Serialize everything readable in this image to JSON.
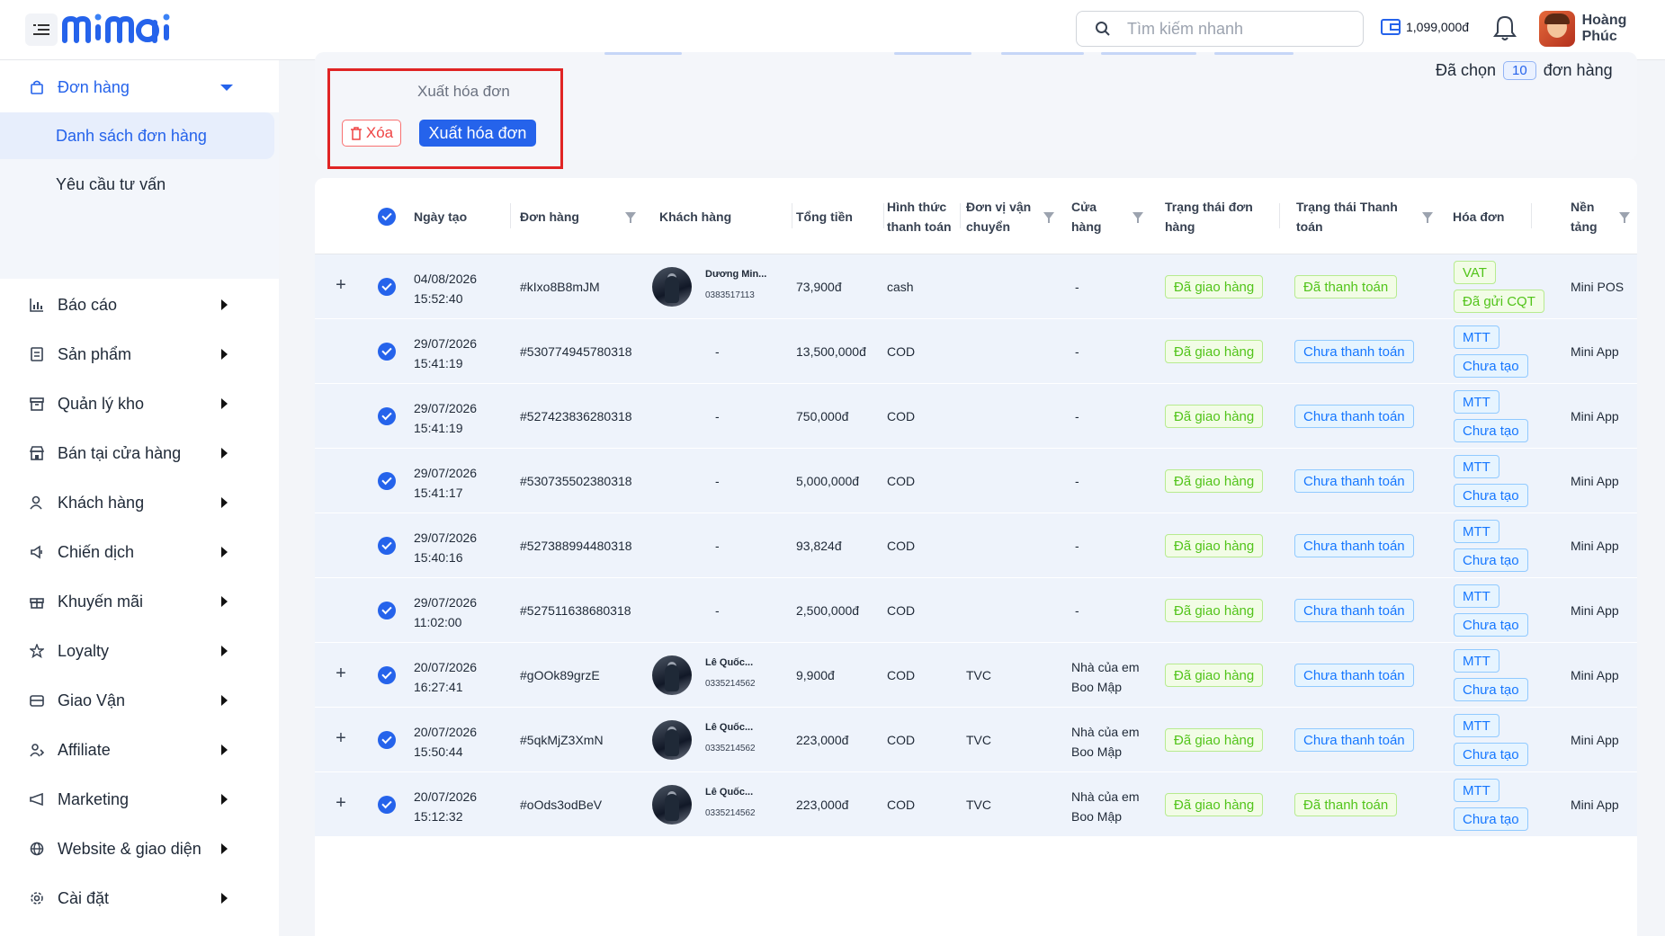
{
  "header": {
    "logo_text": "mimai",
    "search_placeholder": "Tìm kiếm nhanh",
    "wallet_balance": "1,099,000đ",
    "user_name": "Hoàng Phúc"
  },
  "sidebar": {
    "items": [
      {
        "label": "Đơn hàng",
        "icon": "bag-icon"
      },
      {
        "label": "Báo cáo",
        "icon": "chart-icon"
      },
      {
        "label": "Sản phẩm",
        "icon": "product-icon"
      },
      {
        "label": "Quản lý kho",
        "icon": "warehouse-icon"
      },
      {
        "label": "Bán tại cửa hàng",
        "icon": "store-icon"
      },
      {
        "label": "Khách hàng",
        "icon": "customer-icon"
      },
      {
        "label": "Chiến dịch",
        "icon": "campaign-icon"
      },
      {
        "label": "Khuyến mãi",
        "icon": "gift-icon"
      },
      {
        "label": "Loyalty",
        "icon": "star-icon"
      },
      {
        "label": "Giao Vận",
        "icon": "delivery-icon"
      },
      {
        "label": "Affiliate",
        "icon": "affiliate-icon"
      },
      {
        "label": "Marketing",
        "icon": "megaphone-icon"
      },
      {
        "label": "Website & giao diện",
        "icon": "globe-icon"
      },
      {
        "label": "Cài đặt",
        "icon": "gear-icon"
      }
    ],
    "sub_items": [
      "Danh sách đơn hàng",
      "Yêu cầu tư vấn"
    ]
  },
  "actions": {
    "title": "Xuất hóa đơn",
    "delete_label": "Xóa",
    "export_label": "Xuất hóa đơn",
    "selected_prefix": "Đã chọn",
    "selected_count": "10",
    "selected_suffix": "đơn hàng"
  },
  "table": {
    "columns": {
      "created": "Ngày tạo",
      "order": "Đơn hàng",
      "customer": "Khách hàng",
      "total": "Tổng tiền",
      "payment_method": "Hình thức thanh toán",
      "carrier": "Đơn vị vận chuyển",
      "store": "Cửa hàng",
      "order_status": "Trạng thái đơn hàng",
      "payment_status": "Trạng thái Thanh toán",
      "invoice": "Hóa đơn",
      "platform": "Nền tảng"
    },
    "rows": [
      {
        "date": "04/08/2026",
        "time": "15:52:40",
        "order": "#kIxo8B8mJM",
        "customer_name": "Dương Min...",
        "customer_phone": "0383517113",
        "total": "73,900đ",
        "method": "cash",
        "carrier": "",
        "store": "-",
        "store2": "",
        "order_status": "Đã giao hàng",
        "payment_status": "Đã thanh toán",
        "invoice1": "VAT",
        "invoice2": "Đã gửi CQT",
        "platform": "Mini POS"
      },
      {
        "date": "29/07/2026",
        "time": "15:41:19",
        "order": "#530774945780318",
        "customer_name": "-",
        "customer_phone": "",
        "total": "13,500,000đ",
        "method": "COD",
        "carrier": "",
        "store": "-",
        "store2": "",
        "order_status": "Đã giao hàng",
        "payment_status": "Chưa thanh toán",
        "invoice1": "MTT",
        "invoice2": "Chưa tạo",
        "platform": "Mini App"
      },
      {
        "date": "29/07/2026",
        "time": "15:41:19",
        "order": "#527423836280318",
        "customer_name": "-",
        "customer_phone": "",
        "total": "750,000đ",
        "method": "COD",
        "carrier": "",
        "store": "-",
        "store2": "",
        "order_status": "Đã giao hàng",
        "payment_status": "Chưa thanh toán",
        "invoice1": "MTT",
        "invoice2": "Chưa tạo",
        "platform": "Mini App"
      },
      {
        "date": "29/07/2026",
        "time": "15:41:17",
        "order": "#530735502380318",
        "customer_name": "-",
        "customer_phone": "",
        "total": "5,000,000đ",
        "method": "COD",
        "carrier": "",
        "store": "-",
        "store2": "",
        "order_status": "Đã giao hàng",
        "payment_status": "Chưa thanh toán",
        "invoice1": "MTT",
        "invoice2": "Chưa tạo",
        "platform": "Mini App"
      },
      {
        "date": "29/07/2026",
        "time": "15:40:16",
        "order": "#527388994480318",
        "customer_name": "-",
        "customer_phone": "",
        "total": "93,824đ",
        "method": "COD",
        "carrier": "",
        "store": "-",
        "store2": "",
        "order_status": "Đã giao hàng",
        "payment_status": "Chưa thanh toán",
        "invoice1": "MTT",
        "invoice2": "Chưa tạo",
        "platform": "Mini App"
      },
      {
        "date": "29/07/2026",
        "time": "11:02:00",
        "order": "#527511638680318",
        "customer_name": "-",
        "customer_phone": "",
        "total": "2,500,000đ",
        "method": "COD",
        "carrier": "",
        "store": "-",
        "store2": "",
        "order_status": "Đã giao hàng",
        "payment_status": "Chưa thanh toán",
        "invoice1": "MTT",
        "invoice2": "Chưa tạo",
        "platform": "Mini App"
      },
      {
        "date": "20/07/2026",
        "time": "16:27:41",
        "order": "#gOOk89grzE",
        "customer_name": "Lê Quốc...",
        "customer_phone": "0335214562",
        "total": "9,900đ",
        "method": "COD",
        "carrier": "TVC",
        "store": "Nhà của em",
        "store2": "Boo Mập",
        "order_status": "Đã giao hàng",
        "payment_status": "Chưa thanh toán",
        "invoice1": "MTT",
        "invoice2": "Chưa tạo",
        "platform": "Mini App"
      },
      {
        "date": "20/07/2026",
        "time": "15:50:44",
        "order": "#5qkMjZ3XmN",
        "customer_name": "Lê Quốc...",
        "customer_phone": "0335214562",
        "total": "223,000đ",
        "method": "COD",
        "carrier": "TVC",
        "store": "Nhà của em",
        "store2": "Boo Mập",
        "order_status": "Đã giao hàng",
        "payment_status": "Chưa thanh toán",
        "invoice1": "MTT",
        "invoice2": "Chưa tạo",
        "platform": "Mini App"
      },
      {
        "date": "20/07/2026",
        "time": "15:12:32",
        "order": "#oOds3odBeV",
        "customer_name": "Lê Quốc...",
        "customer_phone": "0335214562",
        "total": "223,000đ",
        "method": "COD",
        "carrier": "TVC",
        "store": "Nhà của em",
        "store2": "Boo Mập",
        "order_status": "Đã giao hàng",
        "payment_status": "Đã thanh toán",
        "invoice1": "MTT",
        "invoice2": "Chưa tạo",
        "platform": "Mini App"
      }
    ]
  },
  "colors": {
    "accent": "#2563eb",
    "danger": "#ef4444",
    "success": "#52c41a"
  }
}
